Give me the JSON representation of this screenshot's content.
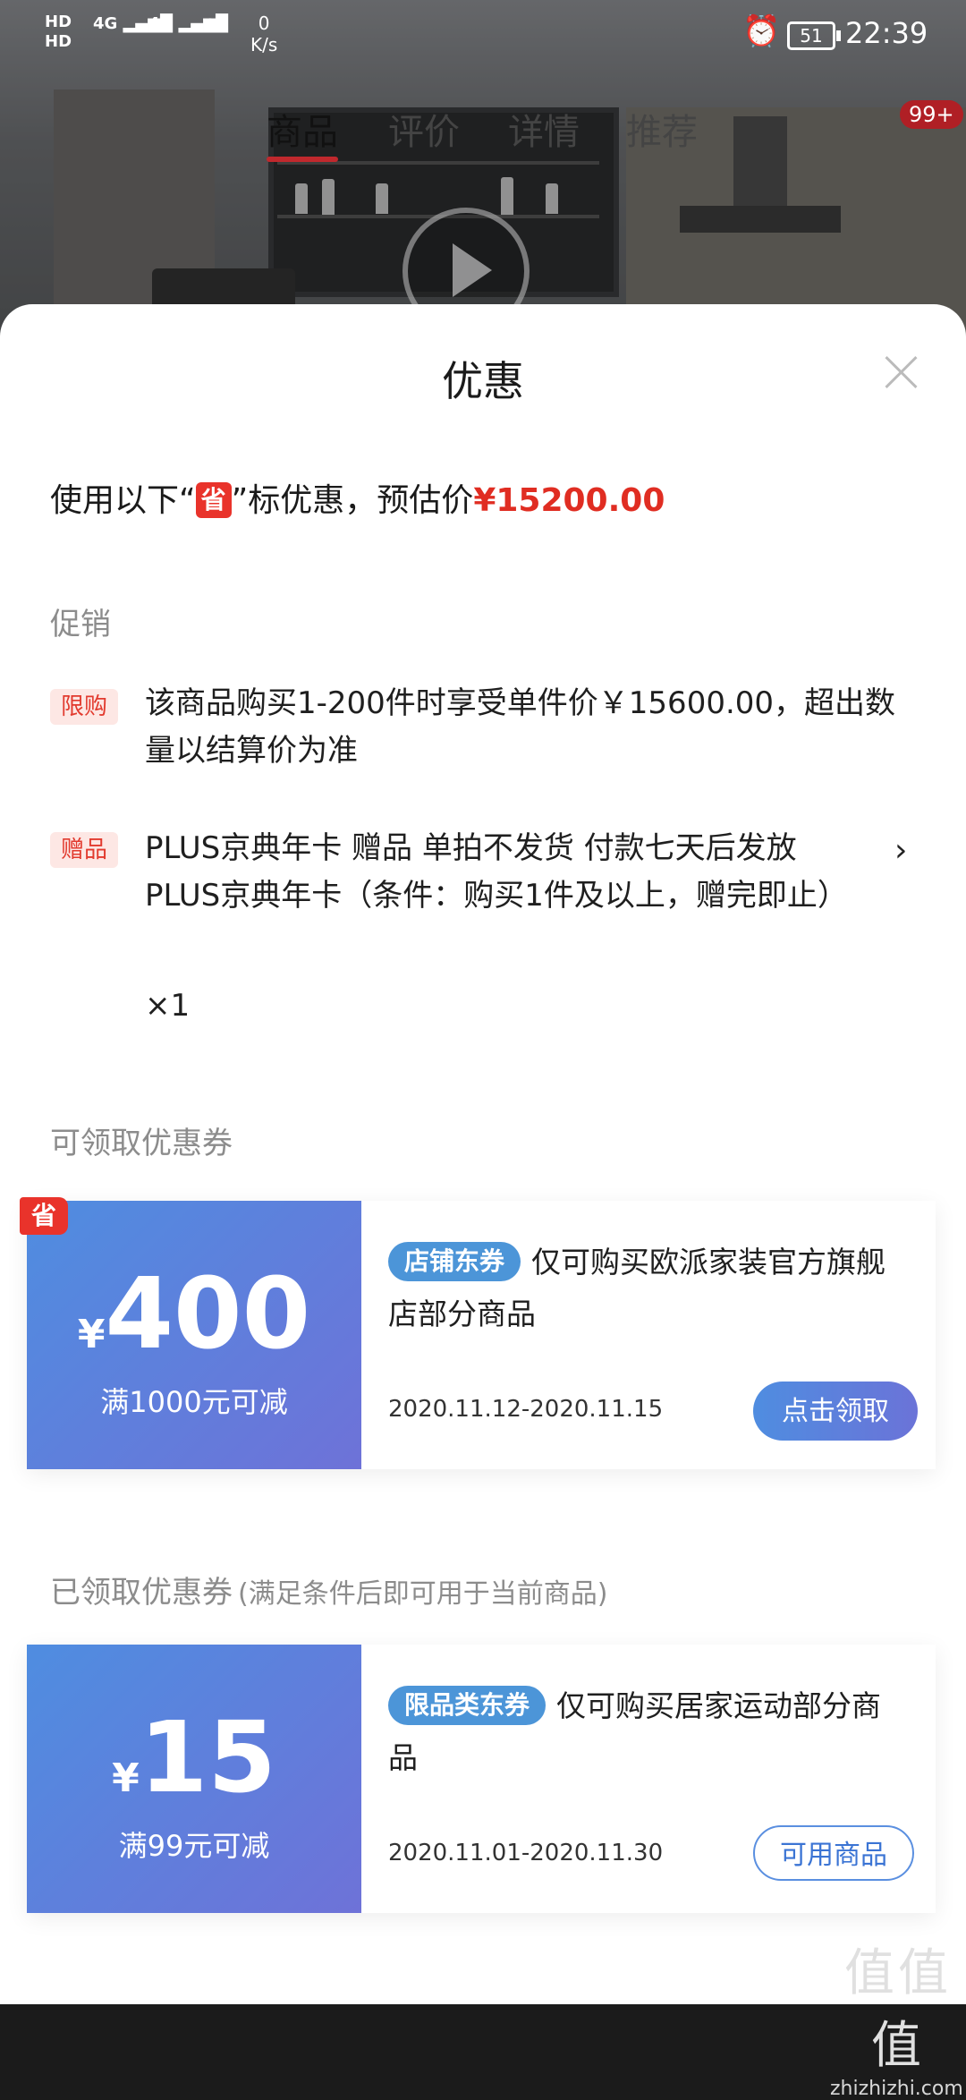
{
  "status_bar": {
    "hd1": "HD",
    "hd2": "HD",
    "net1": "4G",
    "net2": "4G",
    "speed_value": "0",
    "speed_unit": "K/s",
    "battery": "51",
    "time": "22:39"
  },
  "product_nav": {
    "tabs": [
      "商品",
      "评价",
      "详情",
      "推荐"
    ],
    "badge": "99+"
  },
  "sheet": {
    "title": "优惠",
    "summary_prefix": "使用以下“",
    "summary_chip": "省",
    "summary_middle": "”标优惠，预估价",
    "summary_price": "¥15200.00"
  },
  "promotions": {
    "label": "促销",
    "items": [
      {
        "tag": "限购",
        "text": "该商品购买1-200件时享受单件价￥15600.00，超出数量以结算价为准"
      },
      {
        "tag": "赠品",
        "text": "PLUS京典年卡 赠品  单拍不发货 付款七天后发放 PLUS京典年卡（条件：购买1件及以上，赠完即止）",
        "qty": "×1",
        "arrow": "›"
      }
    ]
  },
  "available_coupons": {
    "label": "可领取优惠券",
    "items": [
      {
        "badge": "省",
        "currency": "¥",
        "amount": "400",
        "condition": "满1000元可减",
        "type": "店铺东券",
        "description": "仅可购买欧派家装官方旗舰店部分商品",
        "date_range": "2020.11.12-2020.11.15",
        "action": "点击领取"
      }
    ]
  },
  "received_coupons": {
    "label": "已领取优惠券",
    "note": "(满足条件后即可用于当前商品)",
    "items": [
      {
        "currency": "¥",
        "amount": "15",
        "condition": "满99元可减",
        "type": "限品类东券",
        "description": "仅可购买居家运动部分商品",
        "date_range": "2020.11.01-2020.11.30",
        "action": "可用商品"
      }
    ]
  },
  "watermark": {
    "mark": "值值值",
    "site": "zhizhizhi.com"
  },
  "colors": {
    "accent_red": "#e02d22",
    "coupon_blue": "#4f8de0",
    "coupon_purple": "#6e72d8"
  }
}
